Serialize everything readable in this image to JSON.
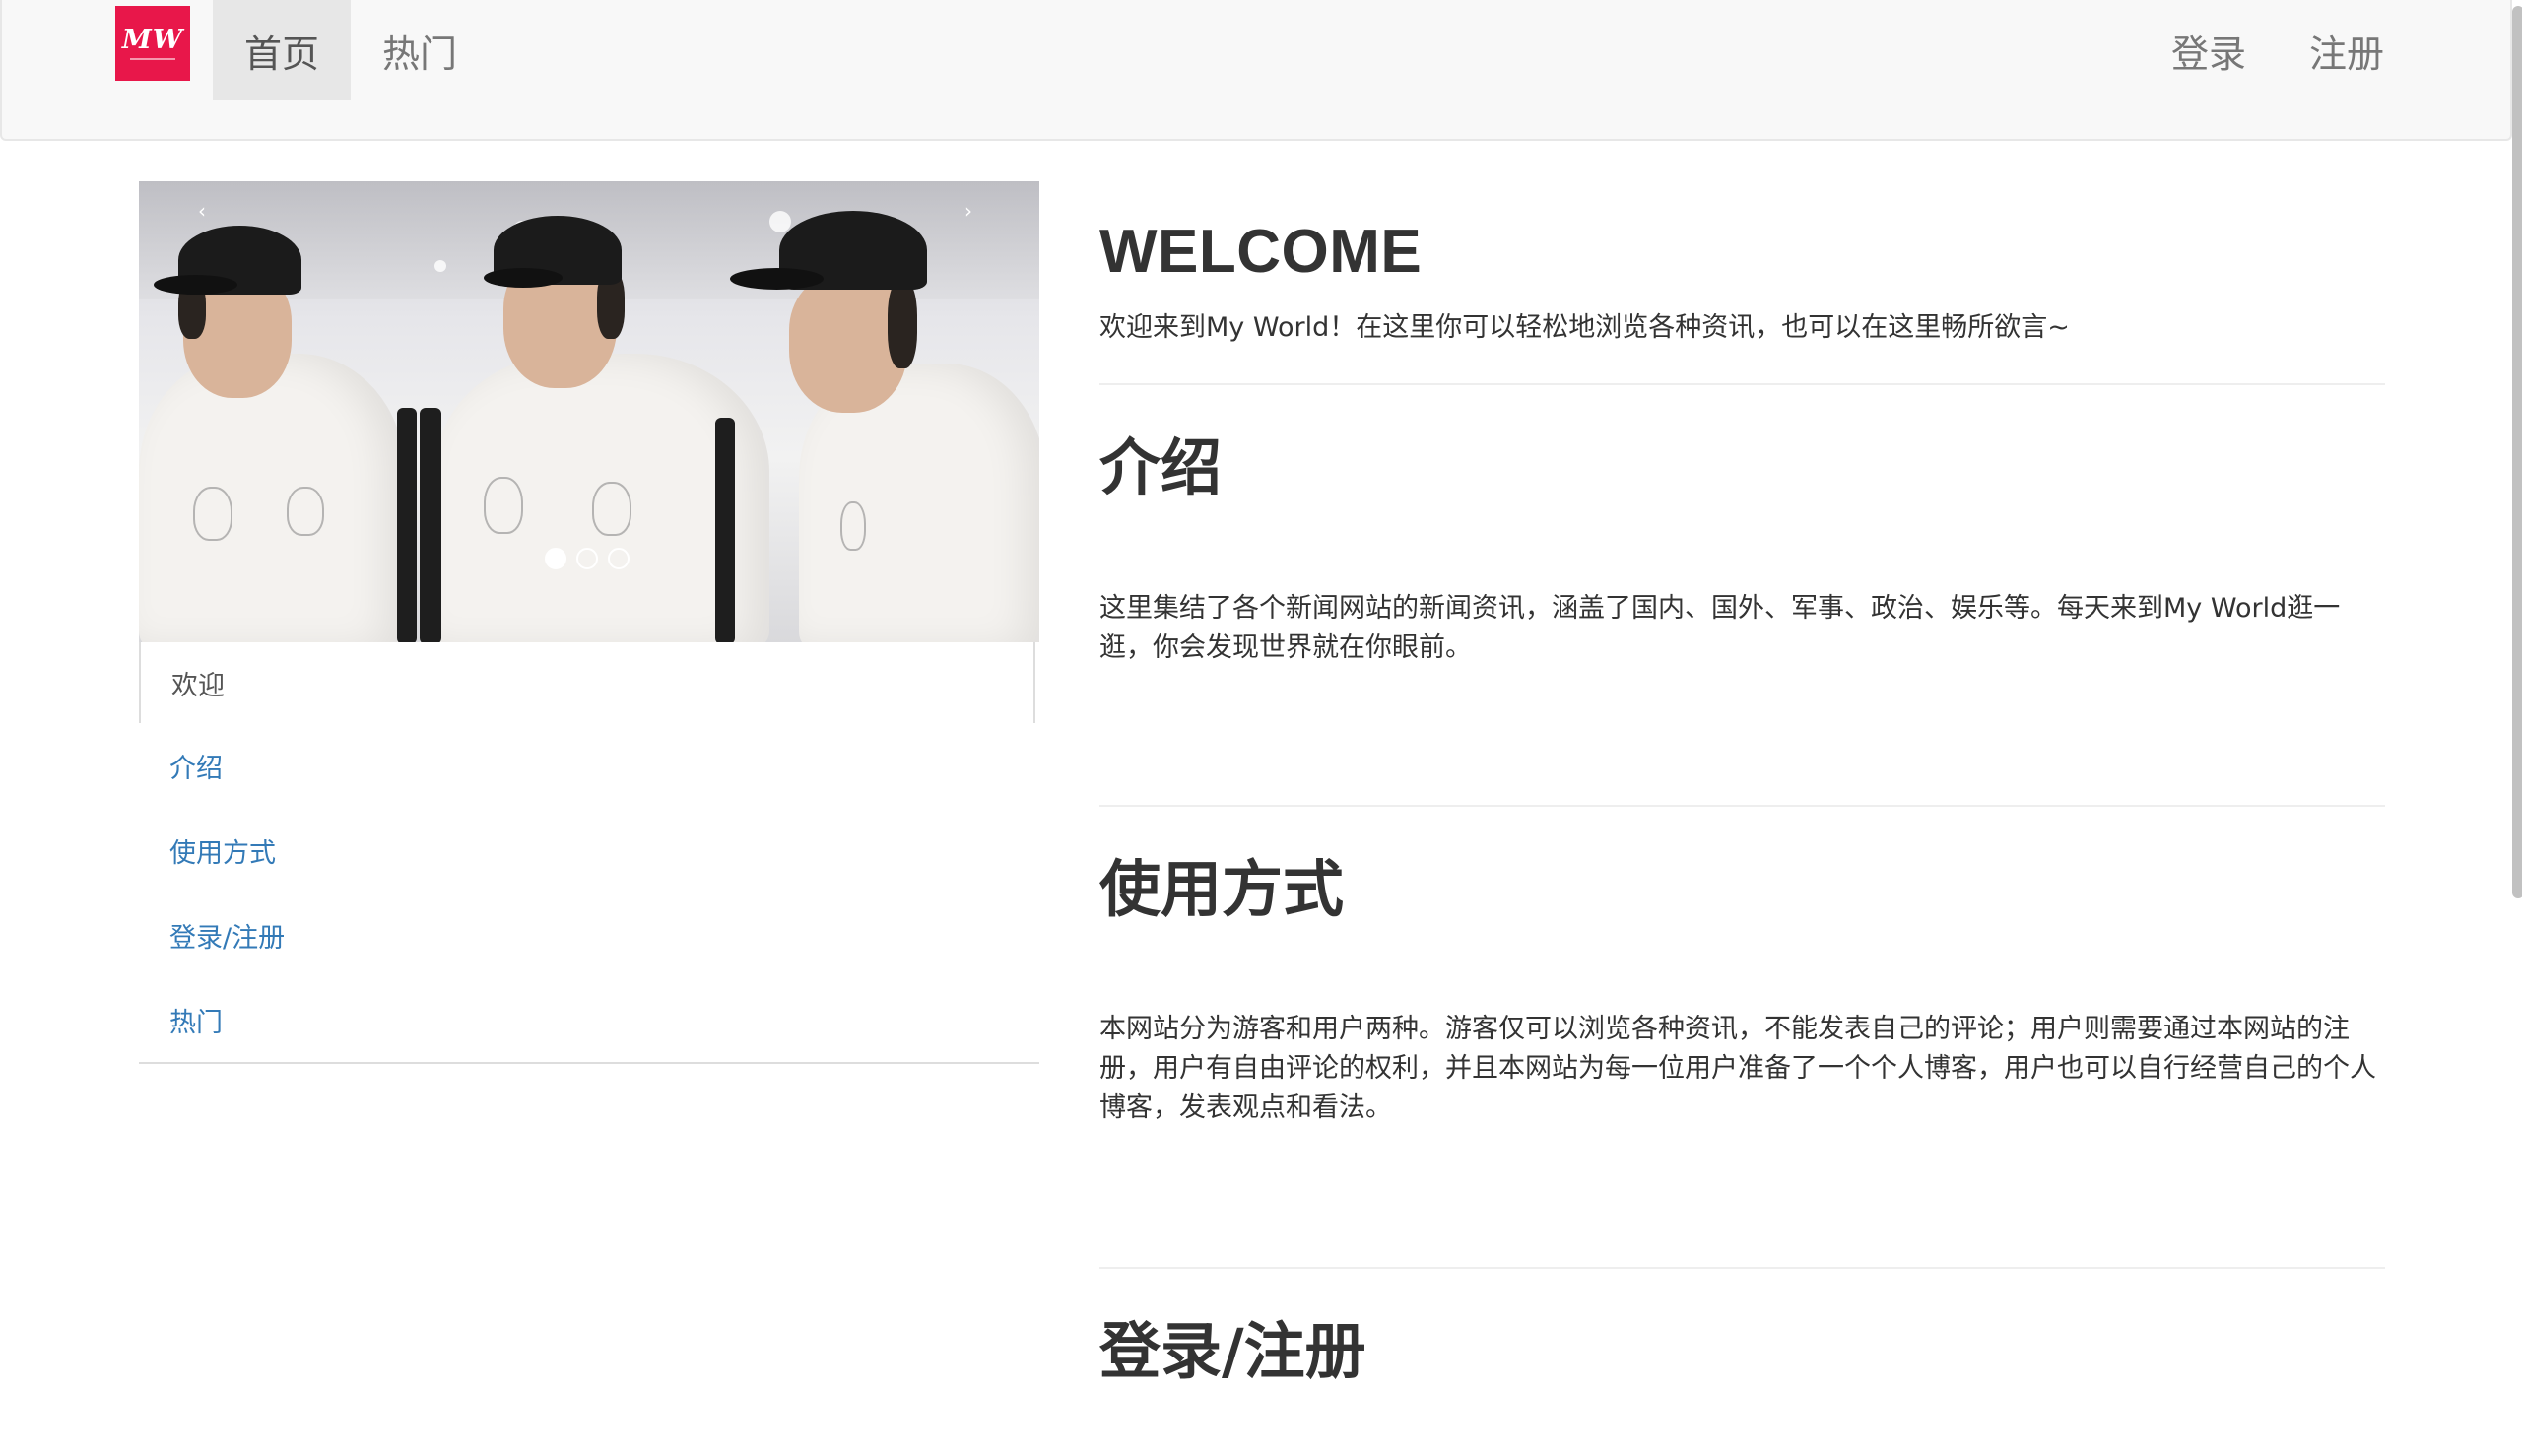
{
  "navbar": {
    "logo_text": "MW",
    "brand_color": "#e8174a",
    "left_items": [
      {
        "label": "首页",
        "active": true
      },
      {
        "label": "热门",
        "active": false
      }
    ],
    "right_items": [
      {
        "label": "登录"
      },
      {
        "label": "注册"
      }
    ]
  },
  "carousel": {
    "prev_icon": "chevron-left-icon",
    "next_icon": "chevron-right-icon",
    "prev_glyph": "‹",
    "next_glyph": "›",
    "slide_count": 3,
    "active_slide": 1
  },
  "sidebar": {
    "items": [
      {
        "label": "欢迎",
        "active": true
      },
      {
        "label": "介绍",
        "active": false
      },
      {
        "label": "使用方式",
        "active": false
      },
      {
        "label": "登录/注册",
        "active": false
      },
      {
        "label": "热门",
        "active": false
      }
    ]
  },
  "main": {
    "welcome_title": "WELCOME",
    "welcome_text": "欢迎来到My World！在这里你可以轻松地浏览各种资讯，也可以在这里畅所欲言~",
    "sections": [
      {
        "title": "介绍",
        "text": "这里集结了各个新闻网站的新闻资讯，涵盖了国内、国外、军事、政治、娱乐等。每天来到My World逛一逛，你会发现世界就在你眼前。"
      },
      {
        "title": "使用方式",
        "text": "本网站分为游客和用户两种。游客仅可以浏览各种资讯，不能发表自己的评论；用户则需要通过本网站的注册，用户有自由评论的权利，并且本网站为每一位用户准备了一个个人博客，用户也可以自行经营自己的个人博客，发表观点和看法。"
      },
      {
        "title": "登录/注册",
        "text": ""
      }
    ]
  }
}
